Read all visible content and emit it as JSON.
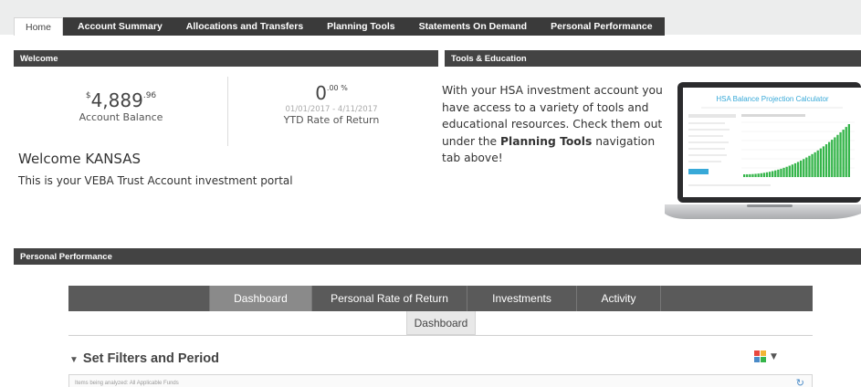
{
  "nav": {
    "tabs": [
      "Home",
      "Account Summary",
      "Allocations and Transfers",
      "Planning Tools",
      "Statements On Demand",
      "Personal Performance"
    ]
  },
  "welcome": {
    "header": "Welcome",
    "balance_whole": "4,889",
    "balance_cents": ".96",
    "balance_currency": "$",
    "balance_label": "Account Balance",
    "ror_value": "0",
    "ror_sup": ".00 %",
    "ror_dates": "01/01/2017 - 4/11/2017",
    "ror_label": "YTD Rate of Return",
    "title": "Welcome KANSAS",
    "subtitle": "This is your VEBA Trust Account investment portal"
  },
  "tools": {
    "header": "Tools & Education",
    "text_before": "With your HSA investment account you have access to a variety of tools and educational resources. Check them out under the ",
    "text_bold": "Planning Tools",
    "text_after": " navigation tab above!",
    "calculator_title": "HSA Balance Projection Calculator"
  },
  "performance": {
    "header": "Personal Performance",
    "tabs": [
      "Dashboard",
      "Personal Rate of Return",
      "Investments",
      "Activity"
    ],
    "active_tab": "Dashboard",
    "sub_tab": "Dashboard",
    "filters_title": "Set Filters and Period",
    "filter_text": "Items being analyzed: All Applicable Funds"
  },
  "colors": {
    "header_bg": "#434343",
    "accent_green": "#35b54a",
    "accent_blue": "#4a8bc8"
  }
}
